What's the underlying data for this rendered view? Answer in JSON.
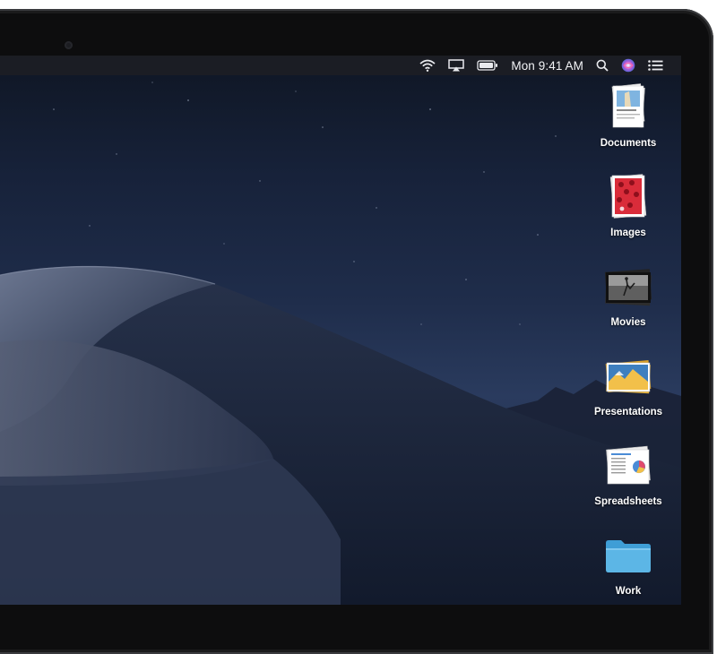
{
  "menubar": {
    "clock": "Mon 9:41 AM",
    "icons": [
      "wifi-icon",
      "airplay-icon",
      "battery-icon",
      "spotlight-search-icon",
      "siri-icon",
      "notification-center-icon"
    ]
  },
  "desktop": {
    "stacks": [
      {
        "label": "Documents",
        "icon": "documents-stack-icon"
      },
      {
        "label": "Images",
        "icon": "images-stack-icon"
      },
      {
        "label": "Movies",
        "icon": "movies-stack-icon"
      },
      {
        "label": "Presentations",
        "icon": "presentations-stack-icon"
      },
      {
        "label": "Spreadsheets",
        "icon": "spreadsheets-stack-icon"
      },
      {
        "label": "Work",
        "icon": "folder-icon"
      }
    ]
  },
  "colors": {
    "sky_top": "#0f1624",
    "dune": "#5b667f",
    "folder_blue": "#5cb6e6"
  }
}
